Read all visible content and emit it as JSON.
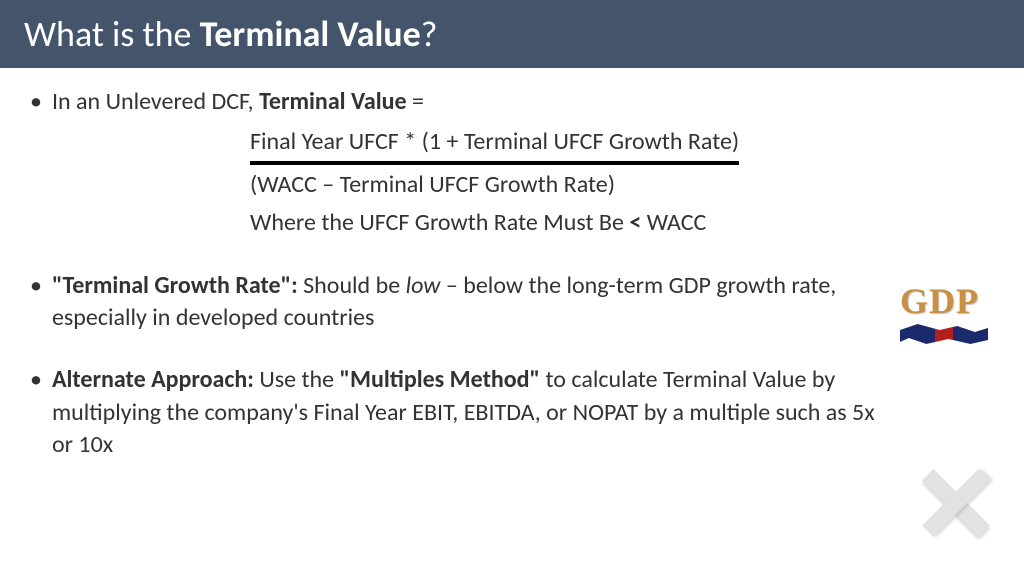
{
  "header": {
    "prefix": "What is the ",
    "emphasis": "Terminal Value",
    "suffix": "?"
  },
  "bullet1": {
    "prefix": "In an Unlevered DCF, ",
    "bold": "Terminal Value",
    "suffix": " ="
  },
  "formula": {
    "numerator": "Final Year UFCF * (1 + Terminal UFCF Growth Rate)",
    "denominator": "(WACC – Terminal UFCF Growth Rate)",
    "constraint_pre": "Where the UFCF Growth Rate Must Be ",
    "constraint_op": "<",
    "constraint_post": " WACC"
  },
  "bullet2": {
    "bold": "\"Terminal Growth Rate\":",
    "text_pre": " Should be ",
    "italic": "low",
    "text_post": " – below the long-term GDP growth rate, especially in developed countries"
  },
  "bullet3": {
    "bold1": "Alternate Approach:",
    "text1": " Use the ",
    "bold2": "\"Multiples Method\"",
    "text2": " to calculate Terminal Value by multiplying the company's Final Year EBIT, EBITDA, or NOPAT by a multiple such as 5x or 10x"
  },
  "icons": {
    "gdp_label": "GDP"
  }
}
